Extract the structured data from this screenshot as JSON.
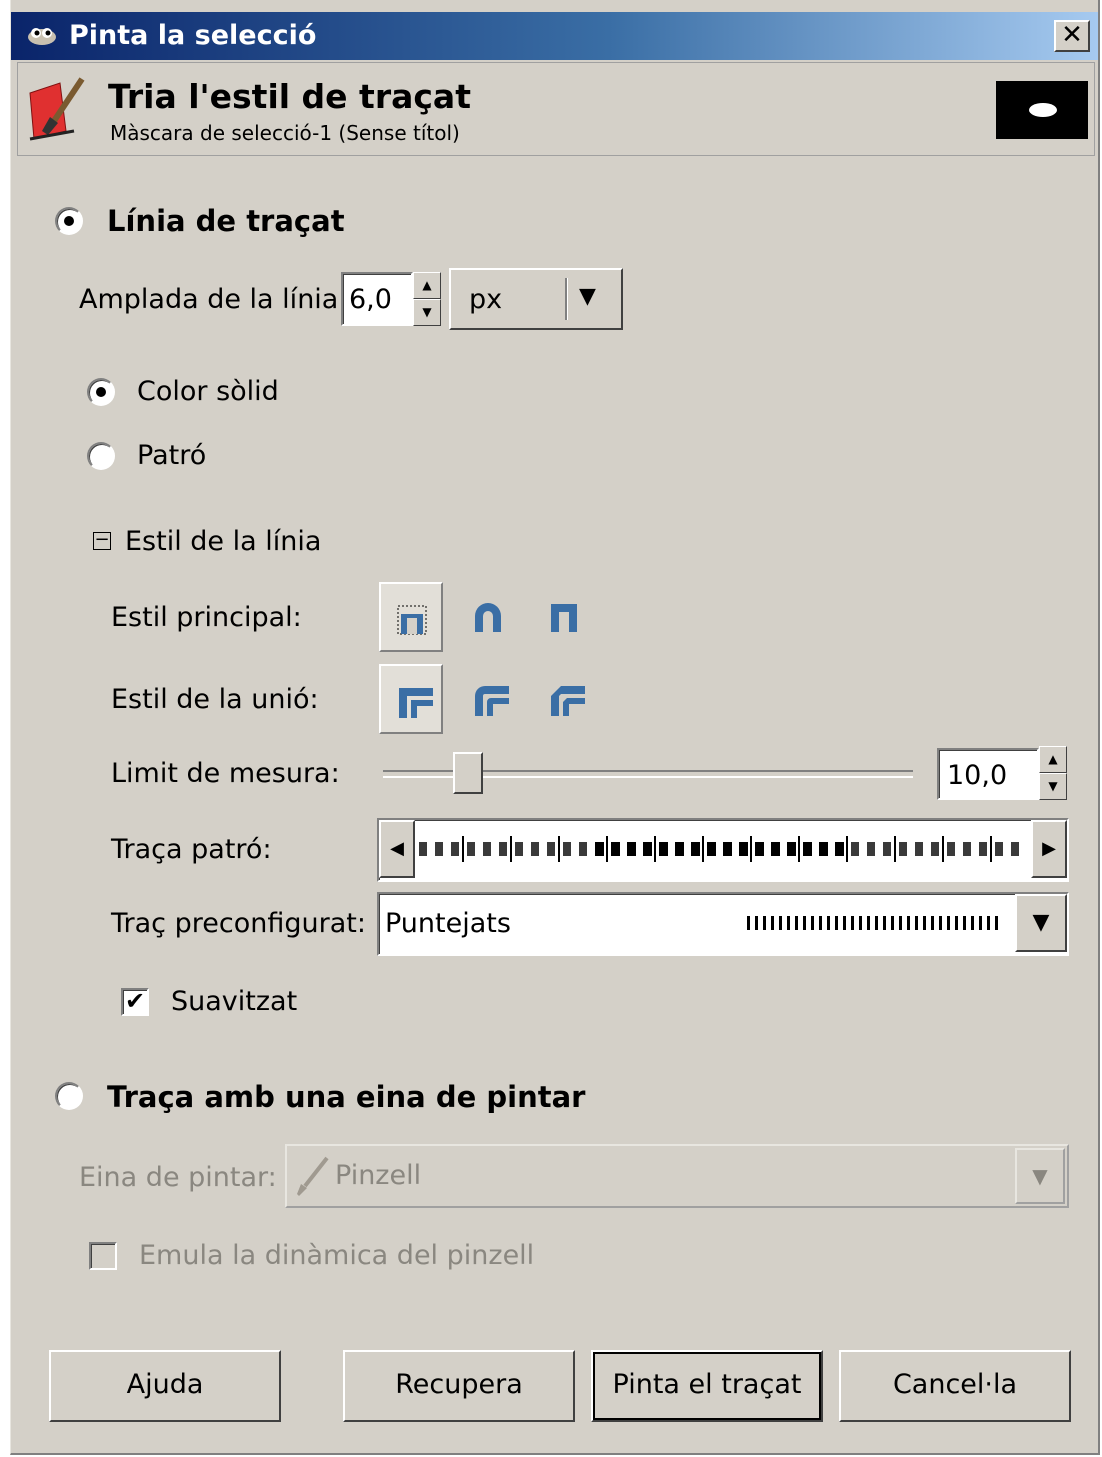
{
  "window": {
    "title": "Pinta la selecció",
    "close_label": "✕"
  },
  "header": {
    "title": "Tria l'estil de traçat",
    "subtitle": "Màscara de selecció-1 (Sense títol)"
  },
  "stroke_line": {
    "label": "Línia de traçat",
    "selected": true,
    "line_width_label": "Amplada de la línia:",
    "line_width_value": "6,0",
    "unit": "px",
    "solid_color_label": "Color sòlid",
    "pattern_label": "Patró",
    "fill_mode": "solid"
  },
  "line_style": {
    "expander_symbol": "−",
    "label": "Estil de la línia",
    "cap_label": "Estil principal:",
    "join_label": "Estil de la unió:",
    "miter_label": "Limit de mesura:",
    "miter_value": "10,0",
    "miter_fraction": 0.12,
    "dash_pattern_label": "Traça patró:",
    "dash_preset_label": "Traç preconfigurat:",
    "dash_preset_value": "Puntejats",
    "antialias_label": "Suavitzat",
    "antialias_checked": true
  },
  "paint_tool": {
    "label": "Traça amb una eina de pintar",
    "selected": false,
    "tool_label": "Eina de pintar:",
    "tool_value": "Pinzell",
    "emulate_label": "Emula la dinàmica del pinzell",
    "emulate_checked": false
  },
  "buttons": {
    "help": "Ajuda",
    "reset": "Recupera",
    "stroke": "Pinta el traçat",
    "cancel": "Cancel·la"
  },
  "colors": {
    "titlebar_start": "#0a246a",
    "titlebar_end": "#a6caf0",
    "dialog_bg": "#d4d0c8",
    "icon_blue": "#3a6ea5"
  }
}
